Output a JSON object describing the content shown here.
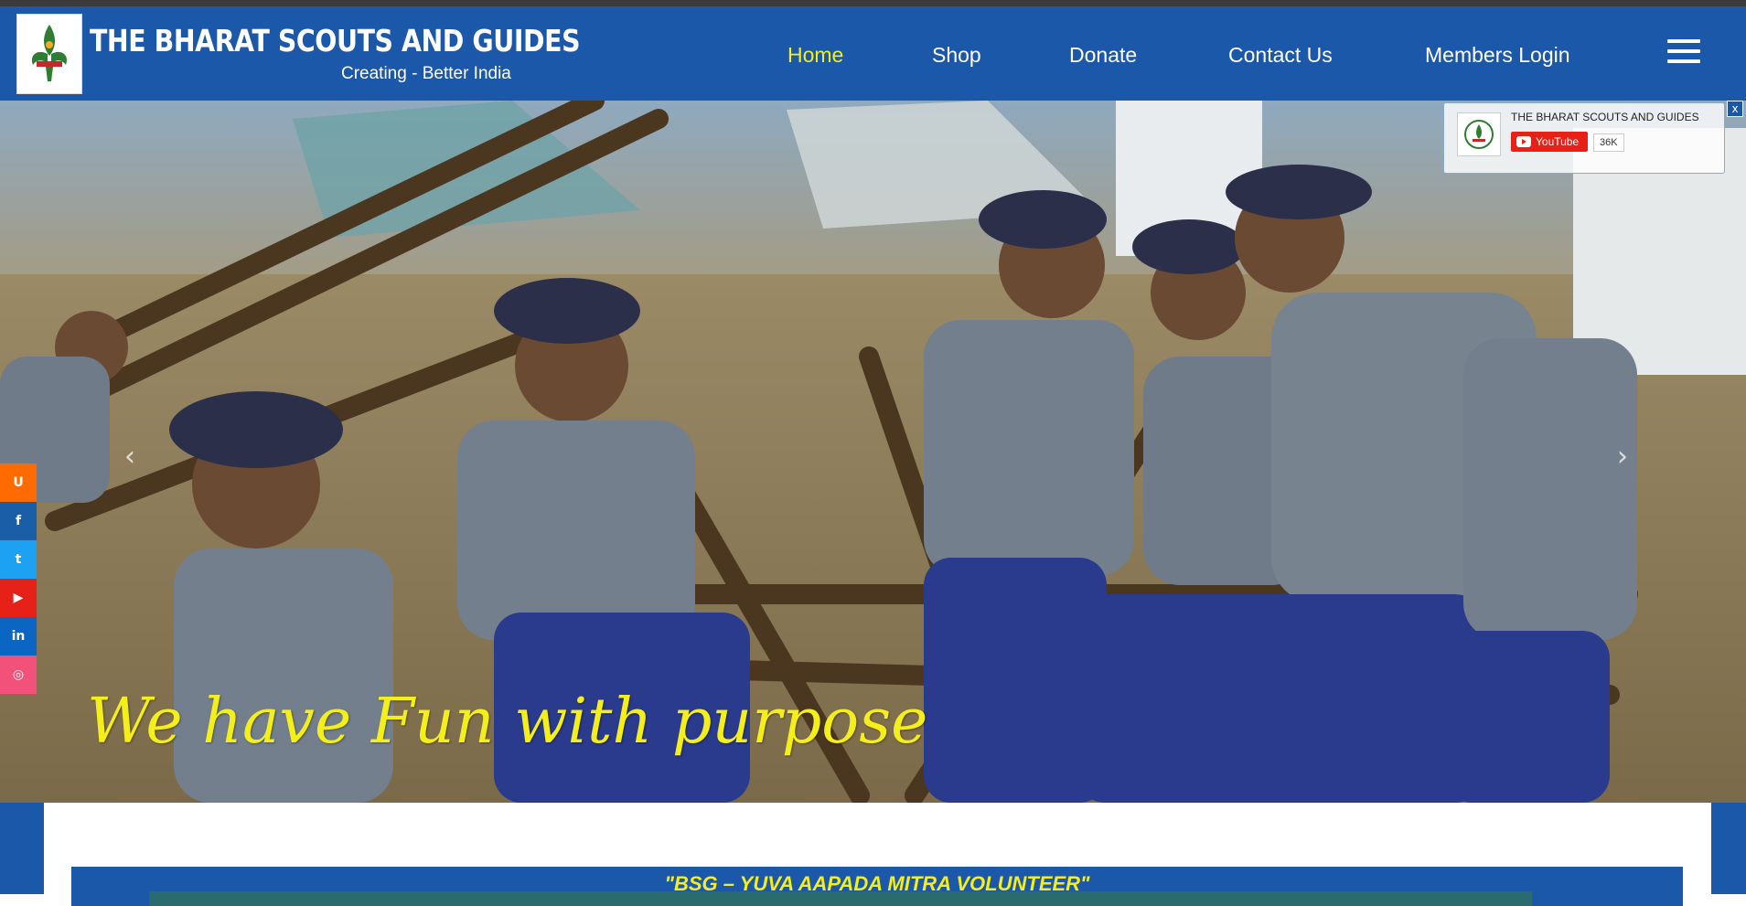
{
  "brand": {
    "title": "THE BHARAT SCOUTS AND GUIDES",
    "tagline": "Creating - Better India",
    "logo_icon": "fleur-de-lis-emblem-icon"
  },
  "nav": {
    "items": [
      {
        "label": "Home",
        "active": true
      },
      {
        "label": "Shop",
        "active": false
      },
      {
        "label": "Donate",
        "active": false
      },
      {
        "label": "Contact Us",
        "active": false
      },
      {
        "label": "Members Login",
        "active": false
      }
    ],
    "menu_icon": "hamburger-menu-icon"
  },
  "hero": {
    "caption": "We have Fun with purpose",
    "prev_icon": "chevron-left-icon",
    "next_icon": "chevron-right-icon"
  },
  "youtube_widget": {
    "channel_name": "THE BHARAT SCOUTS AND GUIDES",
    "button_label": "YouTube",
    "subscriber_count": "36K",
    "close_label": "x"
  },
  "social": [
    {
      "name": "flipboard-icon",
      "glyph": "U",
      "color": "#ff6b00"
    },
    {
      "name": "facebook-icon",
      "glyph": "f",
      "color": "#1a5ea8"
    },
    {
      "name": "twitter-icon",
      "glyph": "t",
      "color": "#1da1f2"
    },
    {
      "name": "youtube-icon",
      "glyph": "▶",
      "color": "#e62117"
    },
    {
      "name": "linkedin-icon",
      "glyph": "in",
      "color": "#0a66c2"
    },
    {
      "name": "instagram-icon",
      "glyph": "◎",
      "color": "#f2527a"
    }
  ],
  "banner": {
    "text": "\"BSG – YUVA AAPADA MITRA VOLUNTEER\""
  },
  "colors": {
    "brand_blue": "#1c58a9",
    "accent_yellow": "#f4ee1a"
  }
}
